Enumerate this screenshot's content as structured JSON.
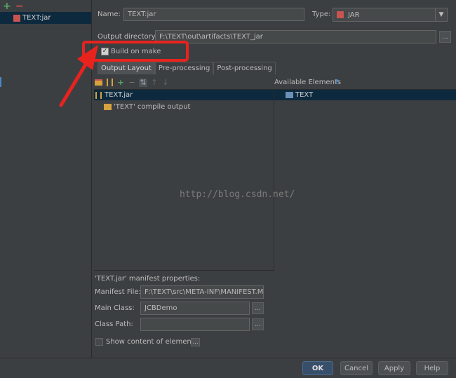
{
  "left_panel": {
    "artifact_name": "TEXT:jar"
  },
  "form": {
    "name_label": "Name:",
    "name_value": "TEXT:jar",
    "type_label": "Type:",
    "type_value": "JAR",
    "output_dir_label": "Output directory:",
    "output_dir_value": "F:\\TEXT\\out\\artifacts\\TEXT_jar",
    "build_on_make_label": "Build on make",
    "build_on_make_checked": true
  },
  "tabs": [
    {
      "label": "Output Layout",
      "active": true
    },
    {
      "label": "Pre-processing",
      "active": false
    },
    {
      "label": "Post-processing",
      "active": false
    }
  ],
  "layout": {
    "available_label": "Available Elements",
    "help_glyph": "?",
    "tree": [
      {
        "label": "TEXT.jar",
        "icon": "jar-bars-icon"
      },
      {
        "label": "'TEXT' compile output",
        "icon": "folder-icon"
      }
    ],
    "available": [
      {
        "label": "TEXT",
        "icon": "module-folder-icon"
      }
    ]
  },
  "watermark": "http://blog.csdn.net/",
  "manifest": {
    "title": "'TEXT.jar' manifest properties:",
    "manifest_file_label": "Manifest File:",
    "manifest_file_value": "F:\\TEXT\\src\\META-INF\\MANIFEST.MF",
    "main_class_label": "Main Class:",
    "main_class_value": "JCBDemo",
    "class_path_label": "Class Path:",
    "class_path_value": "",
    "show_content_label": "Show content of elements",
    "show_content_checked": false
  },
  "buttons": {
    "ok": "OK",
    "cancel": "Cancel",
    "apply": "Apply",
    "help": "Help"
  },
  "dots": "...",
  "colors": {
    "background": "#3c3f41",
    "selection": "#0d293e",
    "annotation_red": "#e8231e",
    "primary_button": "#384f6b"
  }
}
